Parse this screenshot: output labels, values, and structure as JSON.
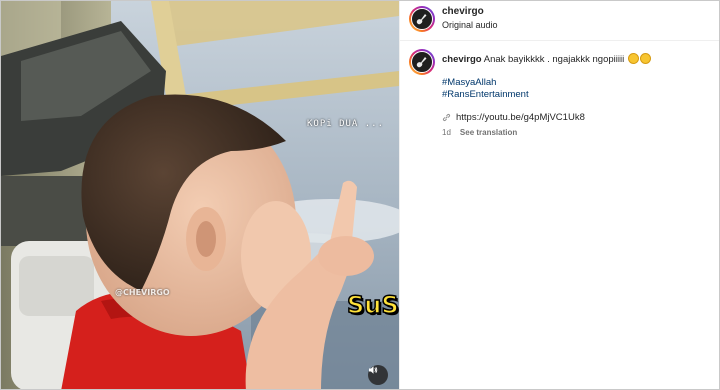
{
  "post": {
    "username": "chevirgo",
    "audio_label": "Original audio"
  },
  "caption": {
    "username": "chevirgo",
    "text": "Anak bayikkkk . ngajakkk ngopiiiii",
    "emojis": [
      "grinning-sweat-emoji",
      "grinning-sweat-emoji"
    ],
    "hashtags": [
      "#MasyaAllah",
      "#RansEntertainment"
    ],
    "link": "https://youtu.be/g4pMjVC1Uk8",
    "age": "1d",
    "translate_label": "See translation"
  },
  "video": {
    "top_caption": "KOPi DUA ...",
    "watermark": "@CHEVIRGO",
    "subtitle": "SuS,",
    "sound_icon": "speaker-icon"
  },
  "colors": {
    "hashtag": "#00376b",
    "meta": "#737373",
    "subtitle_fill": "#ffe23a"
  }
}
